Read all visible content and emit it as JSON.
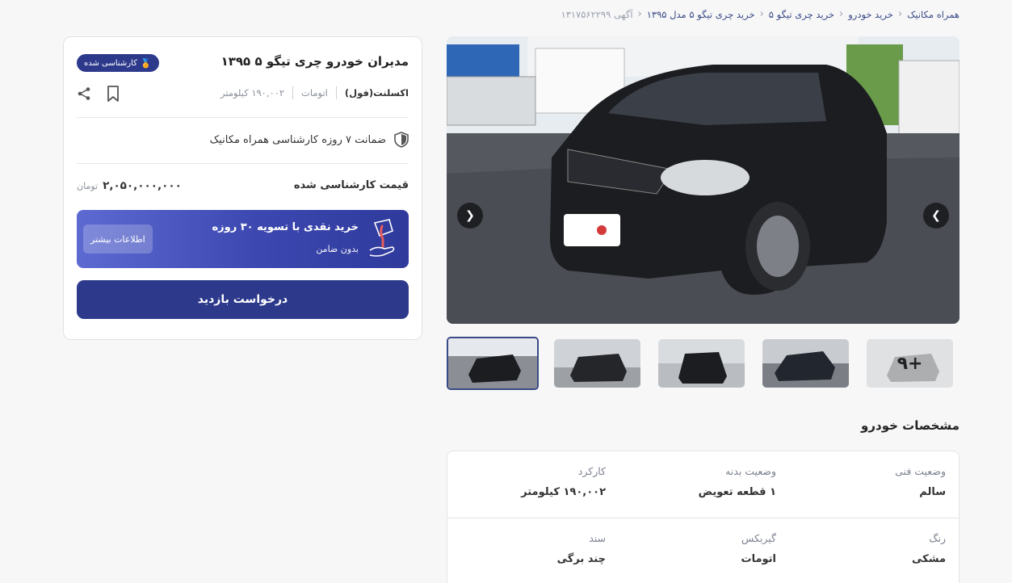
{
  "breadcrumb": {
    "items": [
      "همراه مکانیک",
      "خرید خودرو",
      "خرید چری تیگو ۵",
      "خرید چری تیگو ۵ مدل ۱۳۹۵"
    ],
    "ad_id": "آگهی ۱۳۱۷۵۶۲۲۹۹"
  },
  "listing": {
    "title": "مدیران خودرو چری تیگو ۵ ۱۳۹۵",
    "badge": "کارشناسی شده",
    "trim": "اکسلنت(فول)",
    "gearbox": "اتومات",
    "mileage": "۱۹۰,۰۰۲ کیلومتر",
    "guarantee": "ضمانت ۷ روزه کارشناسی همراه مکانیک",
    "price_label": "قیمت کارشناسی شده",
    "price": "۲,۰۵۰,۰۰۰,۰۰۰",
    "currency": "تومان"
  },
  "cash_offer": {
    "title": "خرید نقدی با تسویه ۳۰ روزه",
    "subtitle": "بدون ضامن",
    "more_label": "اطلاعات بیشتر"
  },
  "visit_button": "درخواست بازدید",
  "gallery": {
    "more_count": "+۹"
  },
  "specs": {
    "title": "مشخصات خودرو",
    "items": [
      {
        "label": "وضعیت فنی",
        "value": "سالم"
      },
      {
        "label": "وضعیت بدنه",
        "value": "۱ قطعه تعویض"
      },
      {
        "label": "کارکرد",
        "value": "۱۹۰,۰۰۲ کیلومتر"
      },
      {
        "label": "رنگ",
        "value": "مشکی"
      },
      {
        "label": "گیربکس",
        "value": "اتومات"
      },
      {
        "label": "سند",
        "value": "چند برگی"
      }
    ]
  },
  "colors": {
    "brand": "#2d3a8c",
    "cash_gradient_start": "#5d6ad1",
    "badge_medal": "#f4b400"
  }
}
